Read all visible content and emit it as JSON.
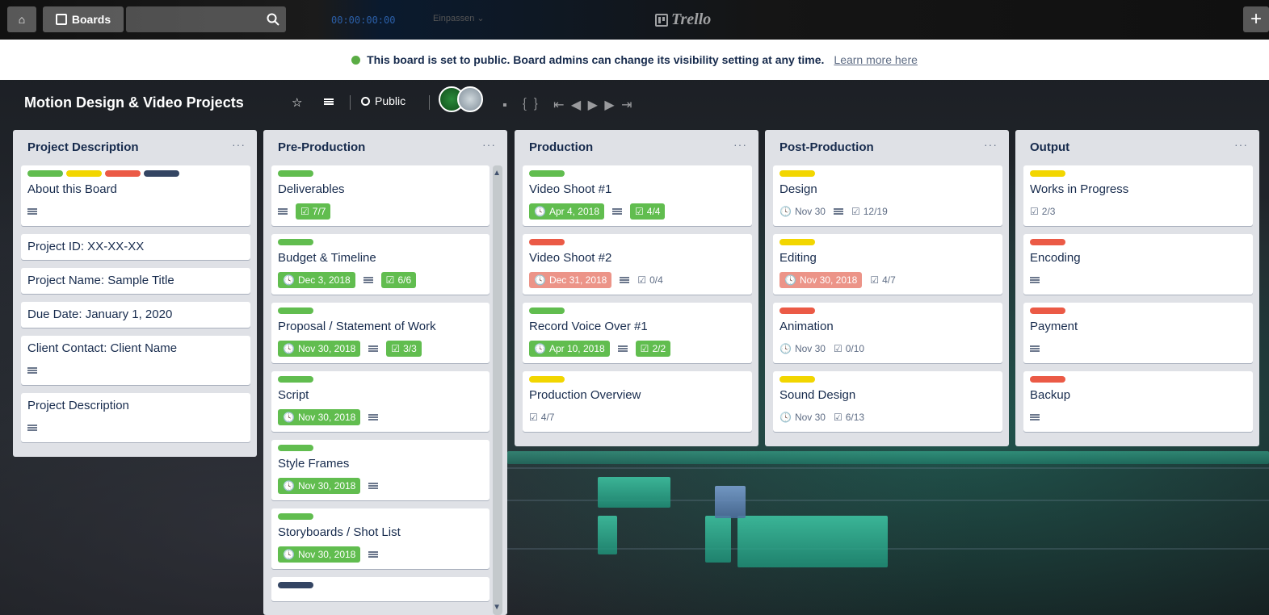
{
  "topbar": {
    "boards_label": "Boards",
    "timecode": "00:00:00:00",
    "zoom_label": "Einpassen",
    "logo_text": "Trello",
    "plus_label": "+"
  },
  "banner": {
    "message": "This board is set to public. Board admins can change its visibility setting at any time.",
    "link": "Learn more here"
  },
  "board": {
    "title": "Motion Design & Video Projects",
    "visibility": "Public"
  },
  "lists": [
    {
      "title": "Project Description",
      "menu": "···",
      "cards": [
        {
          "labels": [
            "green",
            "yellow",
            "red",
            "navy"
          ],
          "title": "About this Board",
          "desc": true
        },
        {
          "title": "Project ID: XX-XX-XX"
        },
        {
          "title": "Project Name: Sample Title"
        },
        {
          "title": "Due Date: January 1, 2020"
        },
        {
          "title": "Client Contact: Client Name",
          "desc": true
        },
        {
          "title": "Project Description",
          "desc": true
        }
      ]
    },
    {
      "title": "Pre-Production",
      "menu": "···",
      "cards": [
        {
          "labels": [
            "green"
          ],
          "title": "Deliverables",
          "desc": true,
          "checklist": "7/7",
          "checklist_done": true
        },
        {
          "labels": [
            "green"
          ],
          "title": "Budget & Timeline",
          "due": "Dec 3, 2018",
          "due_style": "green",
          "desc": true,
          "checklist": "6/6",
          "checklist_done": true
        },
        {
          "labels": [
            "green"
          ],
          "title": "Proposal / Statement of Work",
          "due": "Nov 30, 2018",
          "due_style": "green",
          "desc": true,
          "checklist": "3/3",
          "checklist_done": true
        },
        {
          "labels": [
            "green"
          ],
          "title": "Script",
          "due": "Nov 30, 2018",
          "due_style": "green",
          "desc": true
        },
        {
          "labels": [
            "green"
          ],
          "title": "Style Frames",
          "due": "Nov 30, 2018",
          "due_style": "green",
          "desc": true
        },
        {
          "labels": [
            "green"
          ],
          "title": "Storyboards / Shot List",
          "due": "Nov 30, 2018",
          "due_style": "green",
          "desc": true
        },
        {
          "labels": [
            "navy"
          ],
          "title": ""
        }
      ]
    },
    {
      "title": "Production",
      "menu": "···",
      "cards": [
        {
          "labels": [
            "green"
          ],
          "title": "Video Shoot #1",
          "due": "Apr 4, 2018",
          "due_style": "green",
          "desc": true,
          "checklist": "4/4",
          "checklist_done": true
        },
        {
          "labels": [
            "red"
          ],
          "title": "Video Shoot #2",
          "due": "Dec 31, 2018",
          "due_style": "red",
          "desc": true,
          "checklist": "0/4"
        },
        {
          "labels": [
            "green"
          ],
          "title": "Record Voice Over #1",
          "due": "Apr 10, 2018",
          "due_style": "green",
          "desc": true,
          "checklist": "2/2",
          "checklist_done": true
        },
        {
          "labels": [
            "yellow"
          ],
          "title": "Production Overview",
          "checklist": "4/7"
        }
      ]
    },
    {
      "title": "Post-Production",
      "menu": "···",
      "cards": [
        {
          "labels": [
            "yellow"
          ],
          "title": "Design",
          "due": "Nov 30",
          "due_style": "plain",
          "desc": true,
          "checklist": "12/19"
        },
        {
          "labels": [
            "yellow"
          ],
          "title": "Editing",
          "due": "Nov 30, 2018",
          "due_style": "red",
          "checklist": "4/7"
        },
        {
          "labels": [
            "red"
          ],
          "title": "Animation",
          "due": "Nov 30",
          "due_style": "plain",
          "checklist": "0/10"
        },
        {
          "labels": [
            "yellow"
          ],
          "title": "Sound Design",
          "due": "Nov 30",
          "due_style": "plain",
          "checklist": "6/13"
        }
      ]
    },
    {
      "title": "Output",
      "menu": "···",
      "cards": [
        {
          "labels": [
            "yellow"
          ],
          "title": "Works in Progress",
          "checklist": "2/3"
        },
        {
          "labels": [
            "red"
          ],
          "title": "Encoding",
          "desc": true
        },
        {
          "labels": [
            "red"
          ],
          "title": "Payment",
          "desc": true
        },
        {
          "labels": [
            "red"
          ],
          "title": "Backup",
          "desc": true
        }
      ]
    }
  ]
}
